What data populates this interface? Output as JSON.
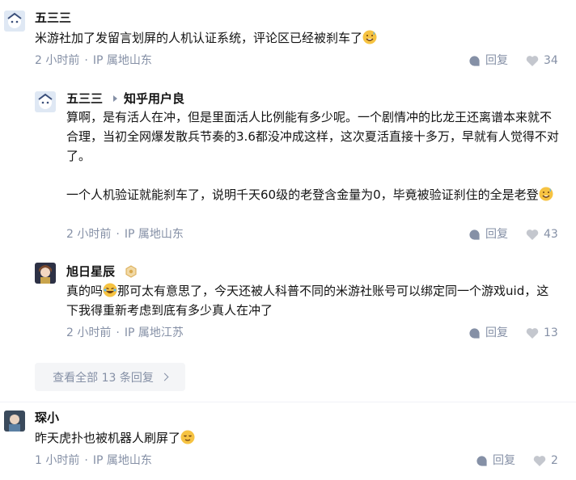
{
  "comments": [
    {
      "author": "五三三",
      "text": "米游社加了发留言划屏的人机认证系统，评论区已经被刹车了",
      "emoji": "sweat-smile",
      "time": "2 小时前",
      "ip": "IP 属地山东",
      "reply_label": "回复",
      "likes": "34"
    },
    {
      "author": "五三三",
      "reply_to": "知乎用户良",
      "text1": "算啊，是有活人在冲，但是里面活人比例能有多少呢。一个剧情冲的比龙王还离谱本来就不合理，当初全网爆发散兵节奏的3.6都没冲成这样，这次夏活直接十多万，早就有人觉得不对了。",
      "text2": "一个人机验证就能刹车了，说明千天60级的老登含金量为0，毕竟被验证刹住的全是老登",
      "emoji": "sweat-smile",
      "time": "2 小时前",
      "ip": "IP 属地山东",
      "reply_label": "回复",
      "likes": "43"
    },
    {
      "author": "旭日星辰",
      "text_a": "真的吗",
      "text_b": "那可太有意思了，今天还被人科普不同的米游社账号可以绑定同一个游戏uid，这下我得重新考虑到底有多少真人在冲了",
      "emoji": "rofl",
      "time": "2 小时前",
      "ip": "IP 属地江苏",
      "reply_label": "回复",
      "likes": "13"
    },
    {
      "author": "琛小",
      "text": "昨天虎扑也被机器人刷屏了",
      "emoji": "relieved",
      "time": "1 小时前",
      "ip": "IP 属地山东",
      "reply_label": "回复",
      "likes": "2"
    }
  ],
  "view_all": "查看全部 13 条回复",
  "colors": {
    "meta": "#8590a6",
    "text": "#121212",
    "button_bg": "#f4f5f7"
  }
}
